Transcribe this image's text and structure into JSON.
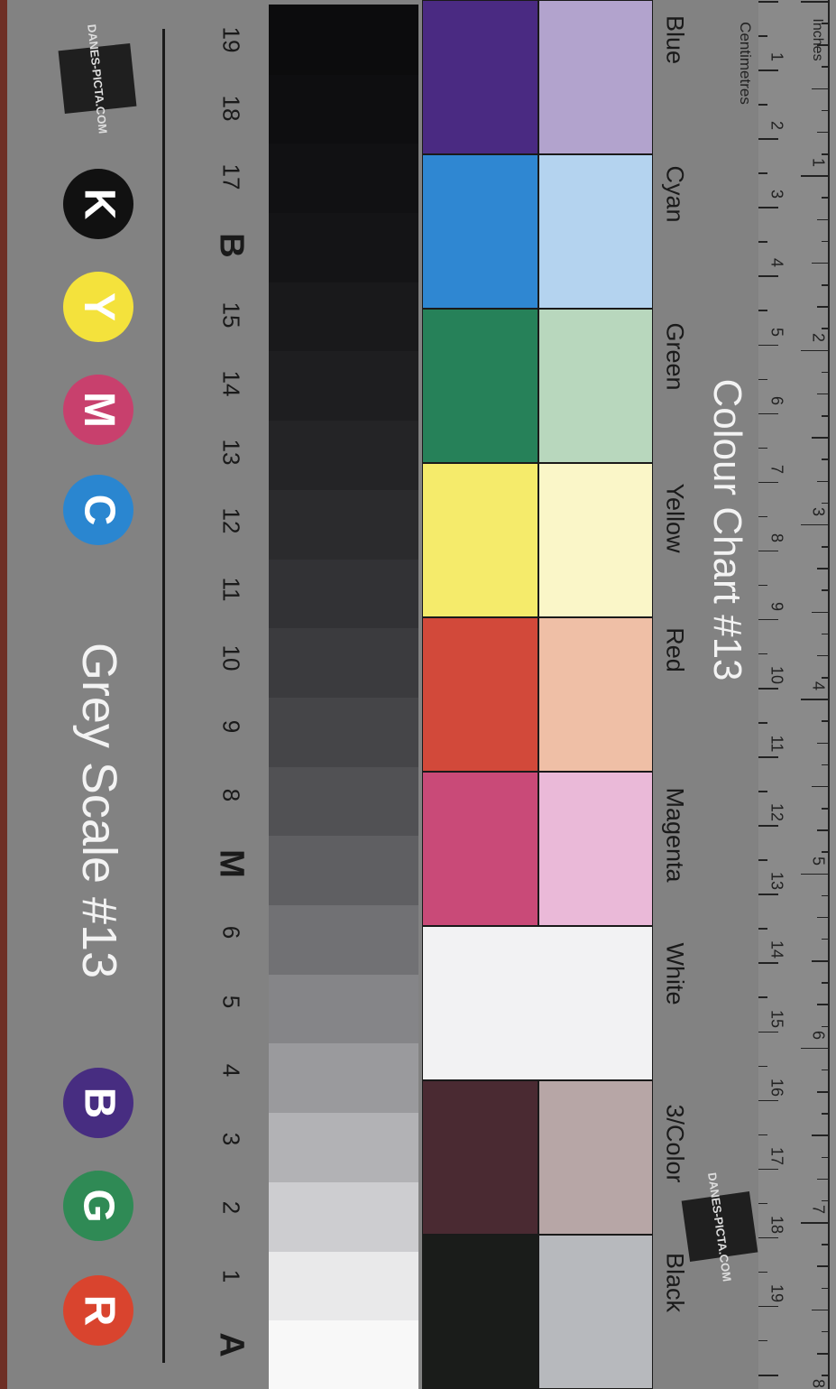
{
  "grey_scale": {
    "title": "Grey Scale #13",
    "rgb_badges": [
      {
        "letter": "R",
        "color": "#d9442e",
        "text_color": "#ffffff"
      },
      {
        "letter": "G",
        "color": "#2f8a55",
        "text_color": "#ffffff"
      },
      {
        "letter": "B",
        "color": "#472d81",
        "text_color": "#ffffff"
      }
    ],
    "cmyk_badges": [
      {
        "letter": "C",
        "color": "#2a86d0",
        "text_color": "#ffffff"
      },
      {
        "letter": "M",
        "color": "#c8406d",
        "text_color": "#ffffff"
      },
      {
        "letter": "Y",
        "color": "#f4e23c",
        "text_color": "#ffffff"
      },
      {
        "letter": "K",
        "color": "#111111",
        "text_color": "#ffffff"
      }
    ],
    "labels": [
      "A",
      "1",
      "2",
      "3",
      "4",
      "5",
      "6",
      "M",
      "8",
      "9",
      "10",
      "11",
      "12",
      "13",
      "14",
      "15",
      "B",
      "17",
      "18",
      "19"
    ],
    "steps": [
      "#f8f8f8",
      "#e9e9ea",
      "#cdcdd0",
      "#b2b2b5",
      "#9a9a9d",
      "#858588",
      "#717174",
      "#5f5f62",
      "#515154",
      "#454548",
      "#3b3b3e",
      "#323235",
      "#2b2b2d",
      "#242426",
      "#1e1e20",
      "#19191b",
      "#141416",
      "#111113",
      "#0e0e10",
      "#0c0c0d"
    ],
    "logo": "DANES-PICTA.COM"
  },
  "colour_chart": {
    "title": "Colour Chart #13",
    "patches": [
      {
        "name": "Blue",
        "dark": "#4a2a82",
        "light": "#b2a3cd"
      },
      {
        "name": "Cyan",
        "dark": "#2f87d2",
        "light": "#b4d3ef"
      },
      {
        "name": "Green",
        "dark": "#268159",
        "light": "#b8d7bd"
      },
      {
        "name": "Yellow",
        "dark": "#f5eb6b",
        "light": "#faf6c8"
      },
      {
        "name": "Red",
        "dark": "#d2493a",
        "light": "#efbfa6"
      },
      {
        "name": "Magenta",
        "dark": "#c94a78",
        "light": "#eab9d8"
      },
      {
        "name": "White",
        "dark": "#f2f2f3",
        "light": "#f2f2f3"
      },
      {
        "name": "3/Color",
        "dark": "#4a2a32",
        "light": "#b7a6a6"
      },
      {
        "name": "Black",
        "dark": "#1a1c1a",
        "light": "#b7b9bd"
      }
    ],
    "logo": "DANES-PICTA.COM"
  },
  "ruler": {
    "inches_label": "Inches",
    "centimetres_label": "Centimetres",
    "cm": [
      "1",
      "2",
      "3",
      "4",
      "5",
      "6",
      "7",
      "8",
      "9",
      "10",
      "11",
      "12",
      "13",
      "14",
      "15",
      "16",
      "17",
      "18",
      "19"
    ],
    "inches": [
      "1",
      "2",
      "3",
      "4",
      "5",
      "6",
      "7",
      "8"
    ]
  }
}
